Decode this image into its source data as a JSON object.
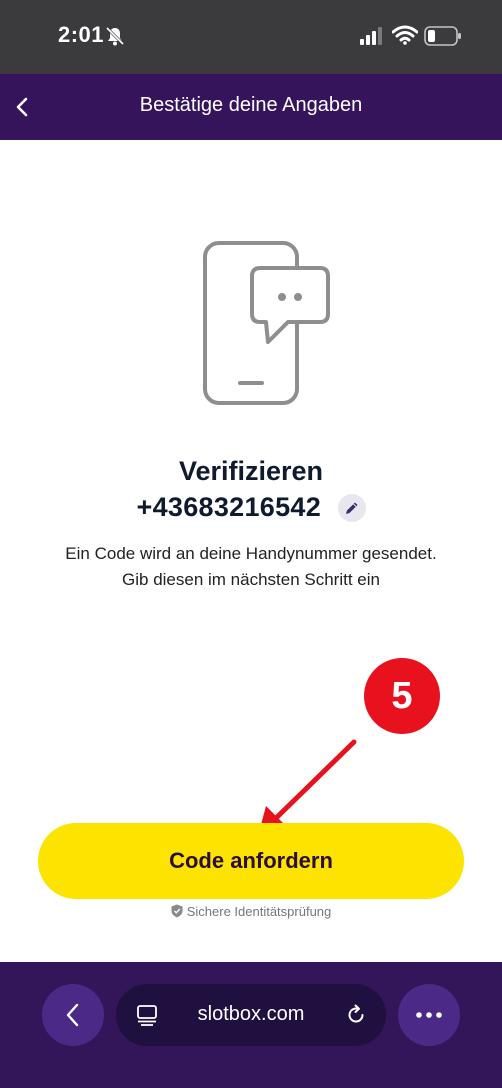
{
  "status_bar": {
    "time": "2:01",
    "icons": [
      "bell-slash-icon",
      "signal-icon",
      "wifi-icon",
      "battery-icon"
    ]
  },
  "header": {
    "title": "Bestätige deine Angaben",
    "back_icon": "chevron-left-icon"
  },
  "main": {
    "illustration_icon": "phone-chat-icon",
    "title": "Verifizieren",
    "phone_number": "+43683216542",
    "edit_icon": "pencil-icon",
    "description_line1": "Ein Code wird an deine Handynummer gesendet.",
    "description_line2": "Gib diesen im nächsten Schritt ein",
    "cta_label": "Code anfordern",
    "secure_label": "Sichere Identitätsprüfung",
    "secure_icon": "shield-check-icon"
  },
  "annotation": {
    "step_number": "5"
  },
  "browser": {
    "url": "slotbox.com",
    "icons": [
      "chevron-left-icon",
      "tabs-icon",
      "reload-icon",
      "more-icon"
    ]
  },
  "colors": {
    "header_bg": "#35145c",
    "cta_bg": "#fce300",
    "badge_bg": "#e8121e",
    "browser_bg": "#33165a"
  }
}
